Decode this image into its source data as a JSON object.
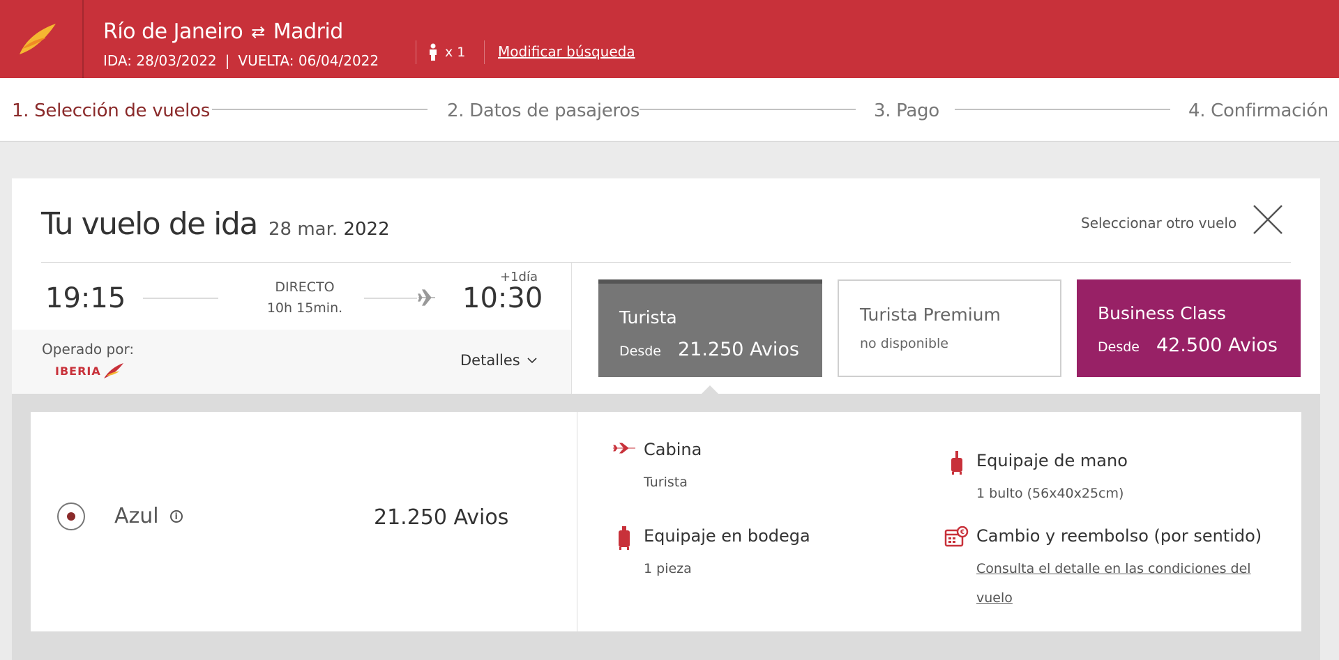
{
  "colors": {
    "brand_red": "#c8313a",
    "step_active": "#8a2a2a",
    "turista_bg": "#767676",
    "business_bg": "#982166"
  },
  "header": {
    "origin": "Río de Janeiro",
    "destination": "Madrid",
    "outbound": "IDA: 28/03/2022",
    "return": "VUELTA: 06/04/2022",
    "passengers": "x 1",
    "modify_label": "Modificar búsqueda"
  },
  "steps": [
    {
      "label": "1. Selección de vuelos",
      "active": true
    },
    {
      "label": "2. Datos de pasajeros"
    },
    {
      "label": "3. Pago"
    },
    {
      "label": "4. Confirmación"
    }
  ],
  "flight": {
    "title": "Tu vuelo de ida",
    "date_day": "28 mar.",
    "date_year": "2022",
    "select_other": "Seleccionar otro vuelo",
    "departure": "19:15",
    "arrival": "10:30",
    "next_day": "+1día",
    "type": "DIRECTO",
    "duration": "10h 15min.",
    "operated_by": "Operado por:",
    "operator": "IBERIA",
    "details_label": "Detalles"
  },
  "fares": {
    "turista": {
      "name": "Turista",
      "from": "Desde",
      "price": "21.250 Avios"
    },
    "premium": {
      "name": "Turista Premium",
      "status": "no disponible"
    },
    "business": {
      "name": "Business Class",
      "from": "Desde",
      "price": "42.500 Avios"
    }
  },
  "tariff": {
    "name": "Azul",
    "price": "21.250 Avios",
    "features": {
      "cabin": {
        "title": "Cabina",
        "value": "Turista"
      },
      "hand": {
        "title": "Equipaje de mano",
        "value": "1 bulto (56x40x25cm)"
      },
      "hold": {
        "title": "Equipaje en bodega",
        "value": "1 pieza"
      },
      "change": {
        "title": "Cambio y reembolso (por sentido)",
        "link_line1": "Consulta el detalle en las condiciones del",
        "link_line2": "vuelo"
      }
    }
  }
}
